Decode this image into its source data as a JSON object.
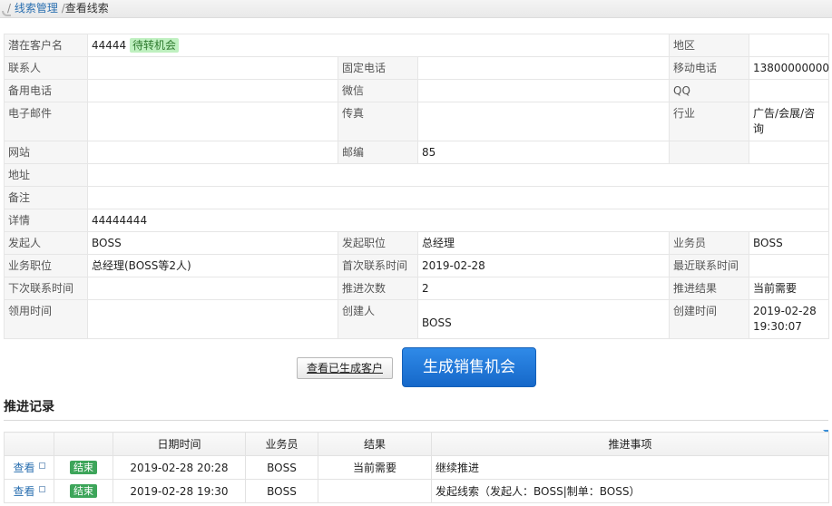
{
  "breadcrumb": {
    "sep1": "/",
    "parent": "线索管理",
    "sep2": "/",
    "current": "查看线索"
  },
  "info": {
    "rows": [
      [
        {
          "l": "潜在客户名",
          "v": "44444",
          "tag": "待转机会",
          "span": 3
        },
        {
          "l": "地区",
          "v": ""
        }
      ],
      [
        {
          "l": "联系人",
          "v": ""
        },
        {
          "l": "固定电话",
          "v": ""
        },
        {
          "l": "移动电话",
          "v": "13800000000"
        }
      ],
      [
        {
          "l": "备用电话",
          "v": ""
        },
        {
          "l": "微信",
          "v": ""
        },
        {
          "l": "QQ",
          "v": ""
        }
      ],
      [
        {
          "l": "电子邮件",
          "v": ""
        },
        {
          "l": "传真",
          "v": ""
        },
        {
          "l": "行业",
          "v": "广告/会展/咨询"
        }
      ],
      [
        {
          "l": "网站",
          "v": ""
        },
        {
          "l": "邮编",
          "v": "85"
        },
        {
          "l": "",
          "v": ""
        }
      ],
      [
        {
          "l": "地址",
          "v": "",
          "span": 5
        }
      ],
      [
        {
          "l": "备注",
          "v": "",
          "span": 5
        }
      ],
      [
        {
          "l": "详情",
          "v": "44444444",
          "span": 5
        }
      ],
      [
        {
          "l": "发起人",
          "v": "BOSS"
        },
        {
          "l": "发起职位",
          "v": "总经理"
        },
        {
          "l": "业务员",
          "v": "BOSS"
        }
      ],
      [
        {
          "l": "业务职位",
          "v": "总经理(BOSS等2人)"
        },
        {
          "l": "首次联系时间",
          "v": "2019-02-28"
        },
        {
          "l": "最近联系时间",
          "v": ""
        }
      ],
      [
        {
          "l": "下次联系时间",
          "v": ""
        },
        {
          "l": "推进次数",
          "v": "2"
        },
        {
          "l": "推进结果",
          "v": "当前需要"
        }
      ],
      [
        {
          "l": "领用时间",
          "v": ""
        },
        {
          "l": "创建人",
          "v": "BOSS"
        },
        {
          "l": "创建时间",
          "v": "2019-02-28 19:30:07"
        }
      ]
    ]
  },
  "buttons": {
    "view_customer": "查看已生成客户",
    "generate": "生成销售机会"
  },
  "records": {
    "title": "推进记录",
    "headers": [
      "",
      "",
      "日期时间",
      "业务员",
      "结果",
      "推进事项"
    ],
    "rows": [
      {
        "action": "查看",
        "status": "结束",
        "datetime": "2019-02-28 20:28",
        "staff": "BOSS",
        "result": "当前需要",
        "item": "继续推进"
      },
      {
        "action": "查看",
        "status": "结束",
        "datetime": "2019-02-28 19:30",
        "staff": "BOSS",
        "result": "",
        "item": "发起线索（发起人：BOSS|制单：BOSS）"
      }
    ]
  }
}
